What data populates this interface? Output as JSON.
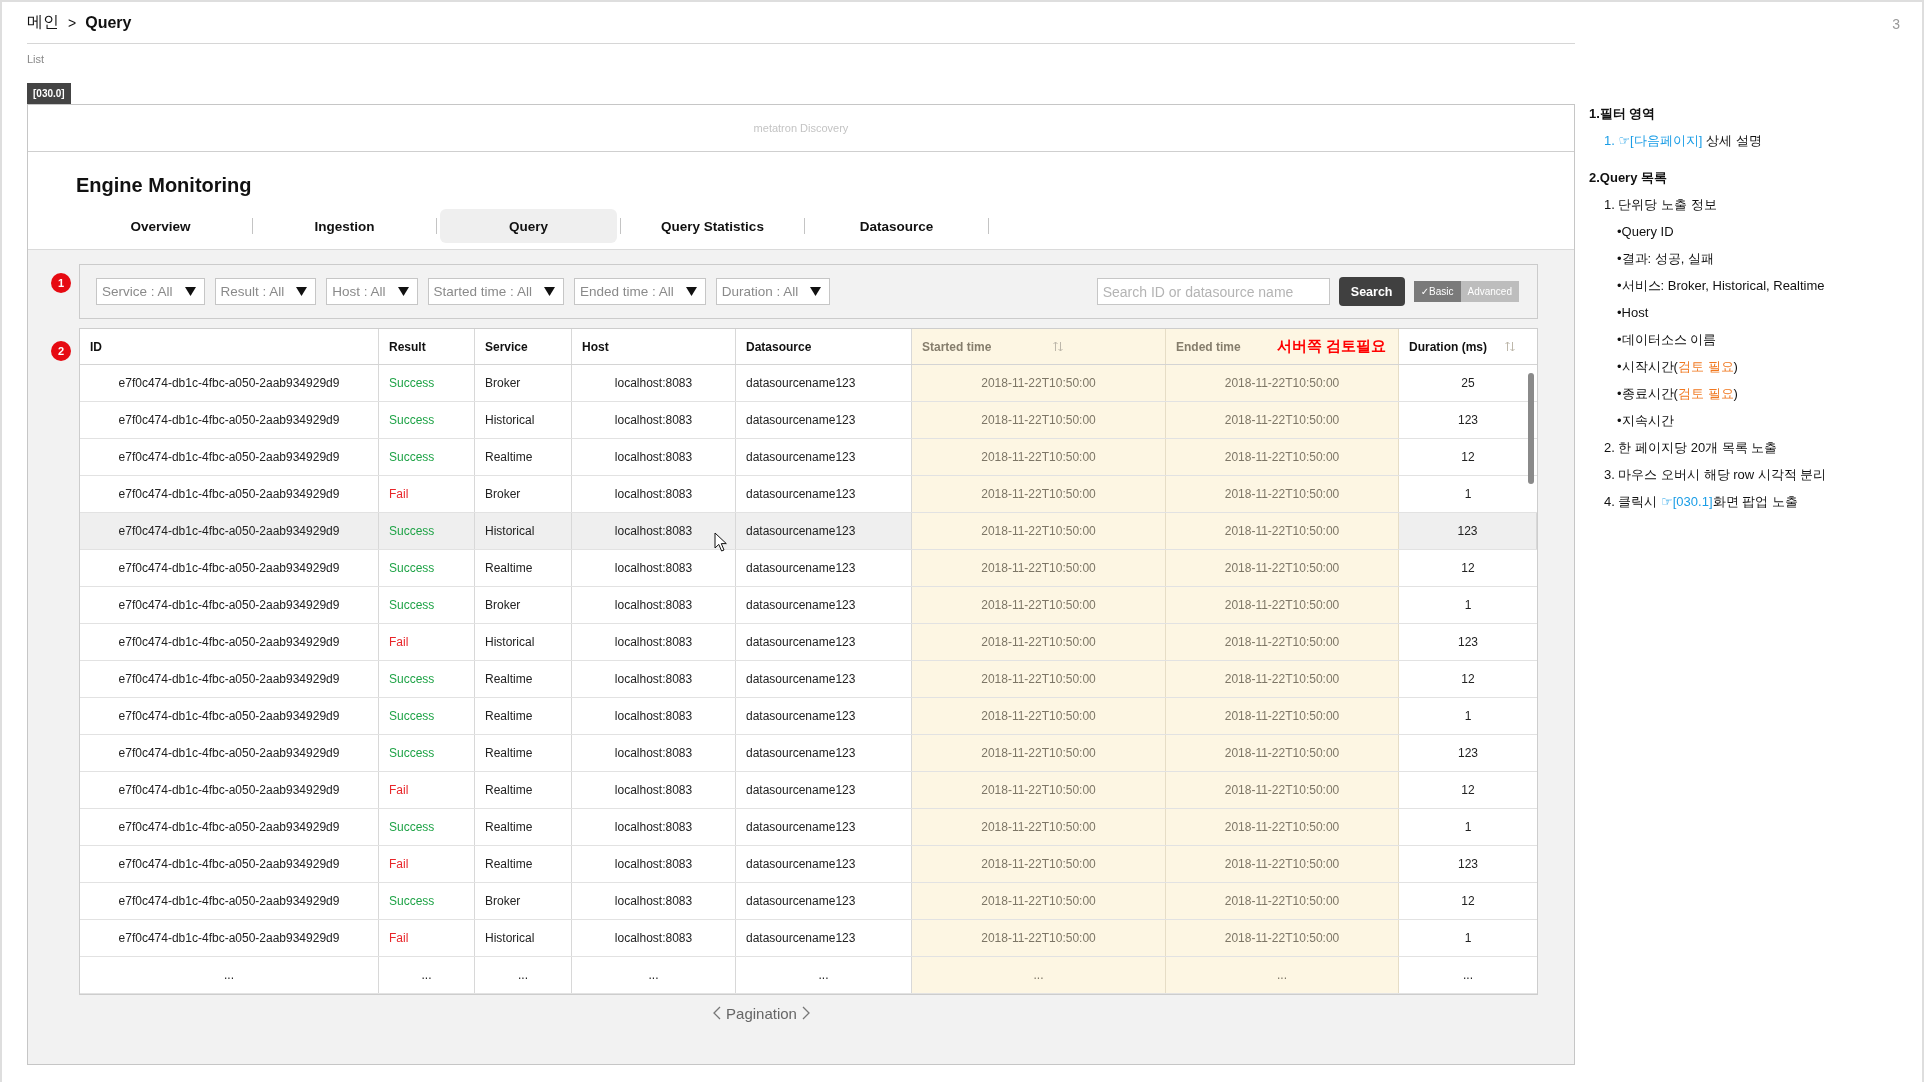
{
  "page_number": "3",
  "breadcrumb": {
    "separator": ">",
    "items": [
      {
        "label": "메인",
        "current": false
      },
      {
        "label": "Query",
        "current": true
      }
    ]
  },
  "subtitle": "List",
  "screen_id": "[030.0]",
  "app_header": {
    "brand": "metatron Discovery"
  },
  "title": "Engine Monitoring",
  "tabs": [
    {
      "label": "Overview",
      "selected": false
    },
    {
      "label": "Ingestion",
      "selected": false
    },
    {
      "label": "Query",
      "selected": true
    },
    {
      "label": "Query Statistics",
      "selected": false
    },
    {
      "label": "Datasource",
      "selected": false
    }
  ],
  "filter_bar": {
    "annotation_marker": "1",
    "dropdowns": [
      {
        "label": "Service : All"
      },
      {
        "label": "Result : All"
      },
      {
        "label": "Host : All"
      },
      {
        "label": "Started time : All"
      },
      {
        "label": "Ended time : All"
      },
      {
        "label": "Duration : All"
      }
    ],
    "search": {
      "placeholder": "Search ID or datasource name"
    },
    "search_button": "Search",
    "mode_toggle": [
      {
        "label": "✓Basic",
        "selected": true
      },
      {
        "label": "Advanced",
        "selected": false
      }
    ]
  },
  "table": {
    "annotation_marker": "2",
    "columns": [
      {
        "label": "ID",
        "sortable": false,
        "highlighted": false
      },
      {
        "label": "Result",
        "sortable": false,
        "highlighted": false
      },
      {
        "label": "Service",
        "sortable": false,
        "highlighted": false
      },
      {
        "label": "Host",
        "sortable": false,
        "highlighted": false
      },
      {
        "label": "Datasource",
        "sortable": false,
        "highlighted": false
      },
      {
        "label": "Started time",
        "sortable": true,
        "highlighted": true
      },
      {
        "label": "Ended time",
        "sortable": false,
        "highlighted": true,
        "note": "서버쪽 검토필요"
      },
      {
        "label": "Duration (ms)",
        "sortable": true,
        "highlighted": false
      }
    ],
    "rows": [
      {
        "id": "e7f0c474-db1c-4fbc-a050-2aab934929d9",
        "result": {
          "label": "Success",
          "color": "#1fa347"
        },
        "service": "Broker",
        "host": "localhost:8083",
        "datasource": "datasourcename123",
        "started_time": "2018-11-22T10:50:00",
        "ended_time": "2018-11-22T10:50:00",
        "duration": "25",
        "hovered": false
      },
      {
        "id": "e7f0c474-db1c-4fbc-a050-2aab934929d9",
        "result": {
          "label": "Success",
          "color": "#1fa347"
        },
        "service": "Historical",
        "host": "localhost:8083",
        "datasource": "datasourcename123",
        "started_time": "2018-11-22T10:50:00",
        "ended_time": "2018-11-22T10:50:00",
        "duration": "123",
        "hovered": false
      },
      {
        "id": "e7f0c474-db1c-4fbc-a050-2aab934929d9",
        "result": {
          "label": "Success",
          "color": "#1fa347"
        },
        "service": "Realtime",
        "host": "localhost:8083",
        "datasource": "datasourcename123",
        "started_time": "2018-11-22T10:50:00",
        "ended_time": "2018-11-22T10:50:00",
        "duration": "12",
        "hovered": false
      },
      {
        "id": "e7f0c474-db1c-4fbc-a050-2aab934929d9",
        "result": {
          "label": "Fail",
          "color": "#e8262a"
        },
        "service": "Broker",
        "host": "localhost:8083",
        "datasource": "datasourcename123",
        "started_time": "2018-11-22T10:50:00",
        "ended_time": "2018-11-22T10:50:00",
        "duration": "1",
        "hovered": false
      },
      {
        "id": "e7f0c474-db1c-4fbc-a050-2aab934929d9",
        "result": {
          "label": "Success",
          "color": "#1fa347"
        },
        "service": "Historical",
        "host": "localhost:8083",
        "datasource": "datasourcename123",
        "started_time": "2018-11-22T10:50:00",
        "ended_time": "2018-11-22T10:50:00",
        "duration": "123",
        "hovered": true
      },
      {
        "id": "e7f0c474-db1c-4fbc-a050-2aab934929d9",
        "result": {
          "label": "Success",
          "color": "#1fa347"
        },
        "service": "Realtime",
        "host": "localhost:8083",
        "datasource": "datasourcename123",
        "started_time": "2018-11-22T10:50:00",
        "ended_time": "2018-11-22T10:50:00",
        "duration": "12",
        "hovered": false
      },
      {
        "id": "e7f0c474-db1c-4fbc-a050-2aab934929d9",
        "result": {
          "label": "Success",
          "color": "#1fa347"
        },
        "service": "Broker",
        "host": "localhost:8083",
        "datasource": "datasourcename123",
        "started_time": "2018-11-22T10:50:00",
        "ended_time": "2018-11-22T10:50:00",
        "duration": "1",
        "hovered": false
      },
      {
        "id": "e7f0c474-db1c-4fbc-a050-2aab934929d9",
        "result": {
          "label": "Fail",
          "color": "#e8262a"
        },
        "service": "Historical",
        "host": "localhost:8083",
        "datasource": "datasourcename123",
        "started_time": "2018-11-22T10:50:00",
        "ended_time": "2018-11-22T10:50:00",
        "duration": "123",
        "hovered": false
      },
      {
        "id": "e7f0c474-db1c-4fbc-a050-2aab934929d9",
        "result": {
          "label": "Success",
          "color": "#1fa347"
        },
        "service": "Realtime",
        "host": "localhost:8083",
        "datasource": "datasourcename123",
        "started_time": "2018-11-22T10:50:00",
        "ended_time": "2018-11-22T10:50:00",
        "duration": "12",
        "hovered": false
      },
      {
        "id": "e7f0c474-db1c-4fbc-a050-2aab934929d9",
        "result": {
          "label": "Success",
          "color": "#1fa347"
        },
        "service": "Realtime",
        "host": "localhost:8083",
        "datasource": "datasourcename123",
        "started_time": "2018-11-22T10:50:00",
        "ended_time": "2018-11-22T10:50:00",
        "duration": "1",
        "hovered": false
      },
      {
        "id": "e7f0c474-db1c-4fbc-a050-2aab934929d9",
        "result": {
          "label": "Success",
          "color": "#1fa347"
        },
        "service": "Realtime",
        "host": "localhost:8083",
        "datasource": "datasourcename123",
        "started_time": "2018-11-22T10:50:00",
        "ended_time": "2018-11-22T10:50:00",
        "duration": "123",
        "hovered": false
      },
      {
        "id": "e7f0c474-db1c-4fbc-a050-2aab934929d9",
        "result": {
          "label": "Fail",
          "color": "#e8262a"
        },
        "service": "Realtime",
        "host": "localhost:8083",
        "datasource": "datasourcename123",
        "started_time": "2018-11-22T10:50:00",
        "ended_time": "2018-11-22T10:50:00",
        "duration": "12",
        "hovered": false
      },
      {
        "id": "e7f0c474-db1c-4fbc-a050-2aab934929d9",
        "result": {
          "label": "Success",
          "color": "#1fa347"
        },
        "service": "Realtime",
        "host": "localhost:8083",
        "datasource": "datasourcename123",
        "started_time": "2018-11-22T10:50:00",
        "ended_time": "2018-11-22T10:50:00",
        "duration": "1",
        "hovered": false
      },
      {
        "id": "e7f0c474-db1c-4fbc-a050-2aab934929d9",
        "result": {
          "label": "Fail",
          "color": "#e8262a"
        },
        "service": "Realtime",
        "host": "localhost:8083",
        "datasource": "datasourcename123",
        "started_time": "2018-11-22T10:50:00",
        "ended_time": "2018-11-22T10:50:00",
        "duration": "123",
        "hovered": false
      },
      {
        "id": "e7f0c474-db1c-4fbc-a050-2aab934929d9",
        "result": {
          "label": "Success",
          "color": "#1fa347"
        },
        "service": "Broker",
        "host": "localhost:8083",
        "datasource": "datasourcename123",
        "started_time": "2018-11-22T10:50:00",
        "ended_time": "2018-11-22T10:50:00",
        "duration": "12",
        "hovered": false
      },
      {
        "id": "e7f0c474-db1c-4fbc-a050-2aab934929d9",
        "result": {
          "label": "Fail",
          "color": "#e8262a"
        },
        "service": "Historical",
        "host": "localhost:8083",
        "datasource": "datasourcename123",
        "started_time": "2018-11-22T10:50:00",
        "ended_time": "2018-11-22T10:50:00",
        "duration": "1",
        "hovered": false
      }
    ],
    "more_row": [
      "...",
      "...",
      "...",
      "...",
      "...",
      "...",
      "...",
      "..."
    ]
  },
  "pagination": {
    "label": "Pagination"
  },
  "notes": [
    {
      "title": "1.필터 영역",
      "items": [
        {
          "parts": [
            {
              "kind": "link",
              "text": "1. ☞[다음페이지]"
            },
            {
              "kind": "plain",
              "text": " 상세 설명"
            }
          ]
        }
      ]
    },
    {
      "title": "2.Query 목록",
      "items": [
        {
          "parts": [
            {
              "kind": "plain",
              "text": "1. 단위당 노출 정보"
            }
          ],
          "children": [
            {
              "parts": [
                {
                  "kind": "plain",
                  "text": "•Query ID"
                }
              ]
            },
            {
              "parts": [
                {
                  "kind": "plain",
                  "text": "•결과: 성공, 실패"
                }
              ]
            },
            {
              "parts": [
                {
                  "kind": "plain",
                  "text": "•서비스: Broker, Historical, Realtime"
                }
              ]
            },
            {
              "parts": [
                {
                  "kind": "plain",
                  "text": "•Host"
                }
              ]
            },
            {
              "parts": [
                {
                  "kind": "plain",
                  "text": "•데이터소스 이름"
                }
              ]
            },
            {
              "parts": [
                {
                  "kind": "plain",
                  "text": "•시작시간("
                },
                {
                  "kind": "warning",
                  "text": "검토 필요"
                },
                {
                  "kind": "plain",
                  "text": ")"
                }
              ]
            },
            {
              "parts": [
                {
                  "kind": "plain",
                  "text": "•종료시간("
                },
                {
                  "kind": "warning",
                  "text": "검토 필요"
                },
                {
                  "kind": "plain",
                  "text": ")"
                }
              ]
            },
            {
              "parts": [
                {
                  "kind": "plain",
                  "text": "•지속시간"
                }
              ]
            }
          ]
        },
        {
          "parts": [
            {
              "kind": "plain",
              "text": "2. 한 페이지당 20개 목록 노출"
            }
          ]
        },
        {
          "parts": [
            {
              "kind": "plain",
              "text": "3. 마우스 오버시 해당 row 시각적 분리"
            }
          ]
        },
        {
          "parts": [
            {
              "kind": "plain",
              "text": "4. 클릭시 "
            },
            {
              "kind": "link",
              "text": "☞[030.1]"
            },
            {
              "kind": "plain",
              "text": "화면 팝업 노출"
            }
          ]
        }
      ]
    }
  ]
}
